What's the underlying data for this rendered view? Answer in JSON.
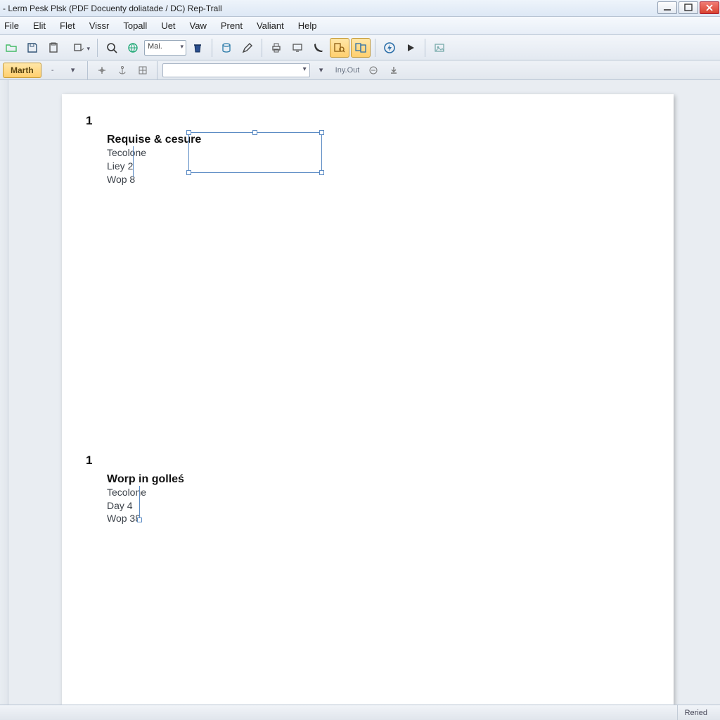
{
  "window": {
    "title": "- Lerm Pesk Plsk (PDF Docuenty doliatade / DC) Rep-Trall"
  },
  "menu": {
    "items": [
      "File",
      "Elit",
      "Flet",
      "Vissr",
      "Topall",
      "Uet",
      "Vaw",
      "Prent",
      "Valiant",
      "Help"
    ]
  },
  "toolbar": {
    "fontbox": "Mai.",
    "layout_label": "Iny.Out"
  },
  "secondary": {
    "pill": "Marth",
    "dash": "-"
  },
  "doc": {
    "block1": {
      "num": "1",
      "heading": "Requise & cesure",
      "l1": "Tecolone",
      "l2": "Liey 2",
      "l3": "Wop 8"
    },
    "block2": {
      "num": "1",
      "heading": "Worp in golleś",
      "l1": "Tecolone",
      "l2": "Day 4",
      "l3": "Wop 38"
    }
  },
  "status": {
    "right": "Reried"
  }
}
